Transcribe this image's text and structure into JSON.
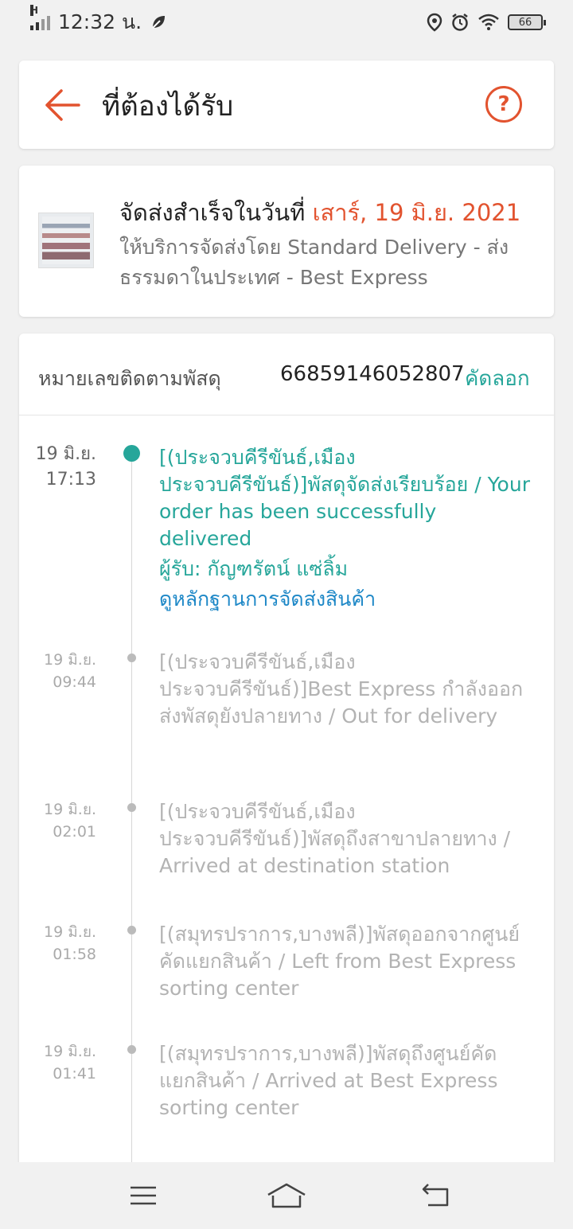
{
  "status_bar": {
    "time": "12:32 น.",
    "network": "H",
    "battery": "66"
  },
  "header": {
    "title": "ที่ต้องได้รับ",
    "help_label": "?"
  },
  "delivery": {
    "completed_prefix": "จัดส่งสำเร็จในวันที่",
    "completed_date": "เสาร์, 19 มิ.ย. 2021",
    "service_text": "ให้บริการจัดส่งโดย Standard Delivery - ส่งธรรมดาในประเทศ - Best Express"
  },
  "tracking": {
    "label": "หมายเลขติดตามพัสดุ",
    "number": "66859146052807",
    "copy_label": "คัดลอก"
  },
  "events": [
    {
      "date": "19 มิ.ย.",
      "time": "17:13",
      "text": "[(ประจวบคีรีขันธ์,เมือง ประจวบคีรีขันธ์)]พัสดุจัดส่งเรียบร้อย / Your order has been successfully delivered",
      "recipient": "ผู้รับ: กัญฑรัตน์ แซ่ลิ้ม",
      "proof_link": "ดูหลักฐานการจัดส่งสินค้า"
    },
    {
      "date": "19 มิ.ย.",
      "time": "09:44",
      "text": "[(ประจวบคีรีขันธ์,เมือง ประจวบคีรีขันธ์)]Best Express กำลังออกส่งพัสดุยังปลายทาง / Out for delivery"
    },
    {
      "date": "19 มิ.ย.",
      "time": "02:01",
      "text": "[(ประจวบคีรีขันธ์,เมือง ประจวบคีรีขันธ์)]พัสดุถึงสาขาปลายทาง / Arrived at destination station"
    },
    {
      "date": "19 มิ.ย.",
      "time": "01:58",
      "text": "[(สมุทรปราการ,บางพลี)]พัสดุออกจากศูนย์คัดแยกสินค้า / Left from Best Express sorting center"
    },
    {
      "date": "19 มิ.ย.",
      "time": "01:41",
      "text": "[(สมุทรปราการ,บางพลี)]พัสดุถึงศูนย์คัดแยกสินค้า / Arrived at Best Express sorting center"
    }
  ],
  "colors": {
    "accent": "#e2532f",
    "teal": "#26a69a",
    "link": "#1e88c7"
  },
  "icons": {
    "back": "arrow-left-icon",
    "help": "question-circle-icon",
    "nav_menu": "menu-icon",
    "nav_home": "home-icon",
    "nav_back": "return-icon"
  }
}
